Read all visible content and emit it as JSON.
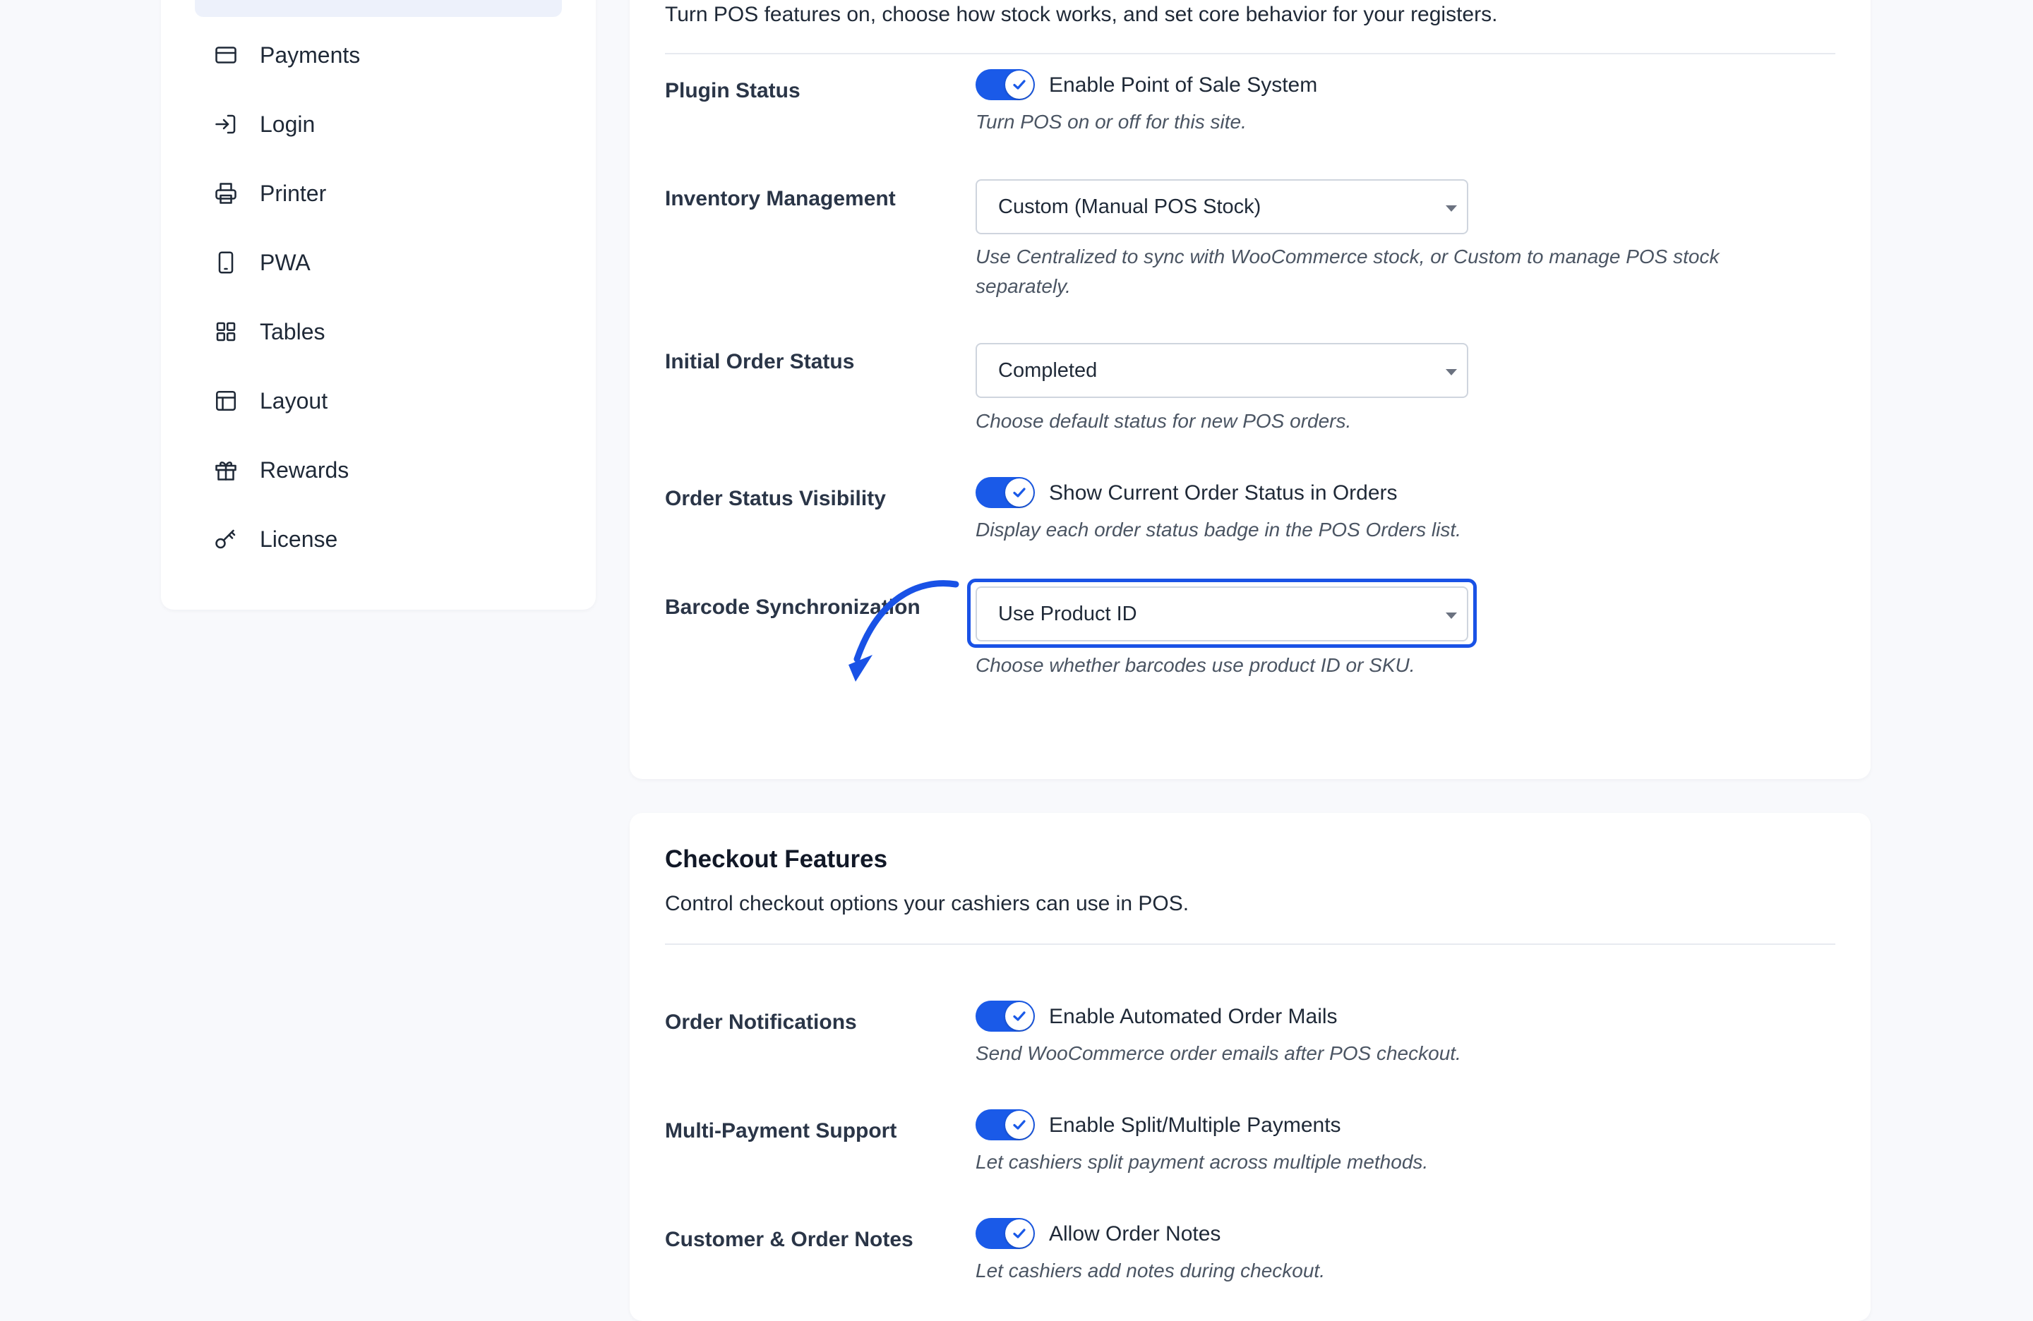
{
  "sidebar": {
    "items": [
      {
        "label": "Payments",
        "icon": "credit-card-icon"
      },
      {
        "label": "Login",
        "icon": "login-icon"
      },
      {
        "label": "Printer",
        "icon": "printer-icon"
      },
      {
        "label": "PWA",
        "icon": "mobile-device-icon"
      },
      {
        "label": "Tables",
        "icon": "grid-icon"
      },
      {
        "label": "Layout",
        "icon": "layout-icon"
      },
      {
        "label": "Rewards",
        "icon": "gift-icon"
      },
      {
        "label": "License",
        "icon": "key-icon"
      }
    ]
  },
  "general": {
    "description": "Turn POS features on, choose how stock works, and set core behavior for your registers.",
    "plugin_status": {
      "label": "Plugin Status",
      "toggle_label": "Enable Point of Sale System",
      "enabled": true,
      "help": "Turn POS on or off for this site."
    },
    "inventory": {
      "label": "Inventory Management",
      "value": "Custom (Manual POS Stock)",
      "help": "Use Centralized to sync with WooCommerce stock, or Custom to manage POS stock separately."
    },
    "initial_status": {
      "label": "Initial Order Status",
      "value": "Completed",
      "help": "Choose default status for new POS orders."
    },
    "status_visibility": {
      "label": "Order Status Visibility",
      "toggle_label": "Show Current Order Status in Orders",
      "enabled": true,
      "help": "Display each order status badge in the POS Orders list."
    },
    "barcode": {
      "label": "Barcode Synchronization",
      "value": "Use Product ID",
      "help": "Choose whether barcodes use product ID or SKU."
    }
  },
  "checkout": {
    "title": "Checkout Features",
    "description": "Control checkout options your cashiers can use in POS.",
    "notifications": {
      "label": "Order Notifications",
      "toggle_label": "Enable Automated Order Mails",
      "enabled": true,
      "help": "Send WooCommerce order emails after POS checkout."
    },
    "multi_payment": {
      "label": "Multi-Payment Support",
      "toggle_label": "Enable Split/Multiple Payments",
      "enabled": true,
      "help": "Let cashiers split payment across multiple methods."
    },
    "notes": {
      "label": "Customer & Order Notes",
      "toggle_label": "Allow Order Notes",
      "enabled": true,
      "help": "Let cashiers add notes during checkout."
    }
  },
  "colors": {
    "accent": "#1a5ae8",
    "highlight": "#1952e6"
  }
}
